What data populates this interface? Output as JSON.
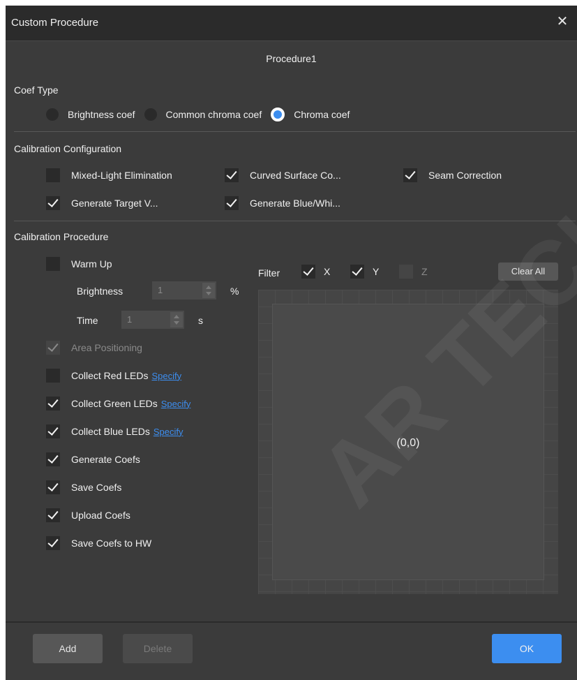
{
  "window": {
    "title": "Custom Procedure"
  },
  "procedure_name": "Procedure1",
  "coef_type": {
    "label": "Coef Type",
    "options": [
      {
        "label": "Brightness coef",
        "selected": false
      },
      {
        "label": "Common chroma coef",
        "selected": false
      },
      {
        "label": "Chroma coef",
        "selected": true
      }
    ]
  },
  "calibration_config": {
    "label": "Calibration Configuration",
    "options": [
      {
        "label": "Mixed-Light Elimination",
        "checked": false
      },
      {
        "label": "Curved Surface Co...",
        "checked": true
      },
      {
        "label": "Seam Correction",
        "checked": true
      },
      {
        "label": "Generate Target V...",
        "checked": true
      },
      {
        "label": "Generate Blue/Whi...",
        "checked": true
      }
    ]
  },
  "calibration_procedure": {
    "label": "Calibration Procedure",
    "warm_up": {
      "label": "Warm Up",
      "checked": false
    },
    "brightness": {
      "label": "Brightness",
      "value": "1",
      "unit": "%"
    },
    "time": {
      "label": "Time",
      "value": "1",
      "unit": "s"
    },
    "area_positioning": {
      "label": "Area Positioning",
      "checked": true,
      "disabled": true
    },
    "collect_red": {
      "label": "Collect Red LEDs",
      "link": "Specify",
      "checked": false
    },
    "collect_green": {
      "label": "Collect Green LEDs",
      "link": "Specify",
      "checked": true
    },
    "collect_blue": {
      "label": "Collect Blue LEDs",
      "link": "Specify",
      "checked": true
    },
    "generate_coefs": {
      "label": "Generate Coefs",
      "checked": true
    },
    "save_coefs": {
      "label": "Save Coefs",
      "checked": true
    },
    "upload_coefs": {
      "label": "Upload Coefs",
      "checked": true
    },
    "save_coefs_hw": {
      "label": "Save Coefs to HW",
      "checked": true
    }
  },
  "filter": {
    "label": "Filter",
    "x": {
      "label": "X",
      "checked": true
    },
    "y": {
      "label": "Y",
      "checked": true
    },
    "z": {
      "label": "Z",
      "checked": false,
      "disabled": true
    },
    "clear_all": "Clear All",
    "coordinate": "(0,0)"
  },
  "buttons": {
    "add": "Add",
    "delete": "Delete",
    "ok": "OK"
  },
  "icons": {
    "close": "close-icon"
  },
  "colors": {
    "accent": "#3c8ef0",
    "background": "#3b3b3b",
    "titlebar": "#2b2b2b"
  }
}
